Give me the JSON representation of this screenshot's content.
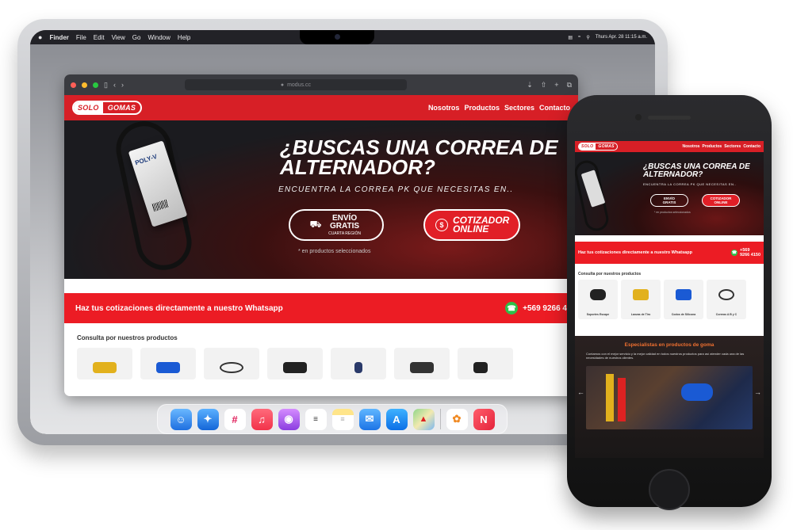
{
  "menubar": {
    "apple": "",
    "app_name": "Finder",
    "items": [
      "File",
      "Edit",
      "View",
      "Go",
      "Window",
      "Help"
    ],
    "clock": "Thurs Apr. 28 11:15 a.m."
  },
  "browser": {
    "url": "modus.cc"
  },
  "site": {
    "logo_part1": "SOLO",
    "logo_part2": "GOMAS",
    "nav": [
      "Nosotros",
      "Productos",
      "Sectores",
      "Contacto"
    ],
    "hero_title": "¿BUSCAS UNA CORREA DE ALTERNADOR?",
    "hero_subtitle": "ENCUENTRA LA CORREA PK QUE NECESITAS EN..",
    "box_label": "POLY-V",
    "cta_envio_main": "ENVÍO GRATIS",
    "cta_envio_small": "CUARTA REGIÓN",
    "cta_cotizador": "COTIZADOR ONLINE",
    "hero_note": "* en productos seleccionados",
    "whatsapp_text": "Haz tus cotizaciones directamente a nuestro Whatsapp",
    "whatsapp_number": "+569 9266 4150",
    "whatsapp_number_cut": "+569 9266 4",
    "products_title": "Consulta por nuestros productos",
    "products": [
      {
        "name": "Soportes Escape",
        "color": "#222222"
      },
      {
        "name": "Lanzas de Tiro",
        "color": "#e2b11d"
      },
      {
        "name": "Codos de Silicona",
        "color": "#1a5ad4"
      },
      {
        "name": "Correas A B y C",
        "color": "#333333"
      }
    ],
    "specialists_title": "Especialistas en productos de goma",
    "specialists_text": "Contamos con el mejor servicio y la mejor calidad en todos nuestros productos para así atender cada una de las necesidades de nuestros clientes."
  },
  "colors": {
    "brand_red": "#d71f26",
    "whatsapp_green": "#2fbf4a",
    "accent_orange": "#f07030"
  },
  "dock": [
    "finder-icon",
    "safari-icon",
    "slack-icon",
    "music-icon",
    "podcasts-icon",
    "reminders-icon",
    "notes-icon",
    "mail-icon",
    "app-store-icon",
    "maps-icon",
    "photos-icon",
    "news-icon"
  ]
}
